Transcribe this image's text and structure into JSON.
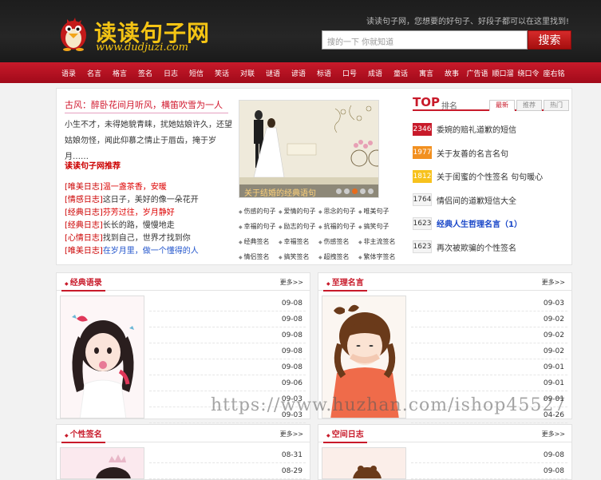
{
  "header": {
    "logo_text": "读读句子网",
    "logo_domain": "www.dudjuzi.com",
    "slogan": "读读句子网，您想要的好句子、好段子都可以在这里找到!",
    "search_placeholder": "搜的一下 你就知道",
    "search_button": "搜索"
  },
  "nav": [
    "语录",
    "名言",
    "格言",
    "签名",
    "日志",
    "短信",
    "笑话",
    "对联",
    "谜语",
    "谚语",
    "标语",
    "口号",
    "成语",
    "童话",
    "寓言",
    "故事",
    "广告语",
    "顺口溜",
    "绕口令",
    "座右铭"
  ],
  "featured": {
    "title": "古风：醉卧花间月听风，横笛吹雪为一人",
    "body": "小生不才，未得她貌青睐，扰她姑娘许久，还望姑娘勿怪，闻此仰慕之情止于唇齿，掩于岁月……"
  },
  "recommend": {
    "title": "读读句子网推荐",
    "items": [
      {
        "cat": "[唯美日志]",
        "text": "温一盏茶香，安暖",
        "style": "red"
      },
      {
        "cat": "[情感日志]",
        "text": "这日子，美好的像一朵花开",
        "style": ""
      },
      {
        "cat": "[经典日志]",
        "text": "芬芳过往，岁月静好",
        "style": "red"
      },
      {
        "cat": "[经典日志]",
        "text": "长长的路，慢慢地走",
        "style": ""
      },
      {
        "cat": "[心情日志]",
        "text": "找到自己，世界才找到你",
        "style": ""
      },
      {
        "cat": "[唯美日志]",
        "text": "在岁月里，做一个懂得的人",
        "style": "blue"
      }
    ]
  },
  "slider": {
    "caption": "关于结婚的经典语句",
    "dots": 5,
    "active_dot": 2
  },
  "tags": [
    "伤感的句子",
    "爱情的句子",
    "思念的句子",
    "唯美句子",
    "幸福的句子",
    "励志的句子",
    "抗福的句子",
    "搞笑句子",
    "经典签名",
    "幸福签名",
    "伤感签名",
    "非主流签名",
    "情侣签名",
    "搞笑签名",
    "超拽签名",
    "繁体字签名"
  ],
  "top": {
    "title": "TOP",
    "subtitle": "排名",
    "tabs": [
      "最新",
      "推荐",
      "热门"
    ],
    "active_tab": 0,
    "items": [
      {
        "num": "2346",
        "text": "委婉的赔礼道歉的短信",
        "rank_class": "r1",
        "hl": false
      },
      {
        "num": "1977",
        "text": "关于友善的名言名句",
        "rank_class": "r2",
        "hl": false
      },
      {
        "num": "1812",
        "text": "关于闺蜜的个性签名 句句暖心",
        "rank_class": "r3",
        "hl": false
      },
      {
        "num": "1764",
        "text": "情侣间的道歉短信大全",
        "rank_class": "",
        "hl": false
      },
      {
        "num": "1623",
        "text": "经典人生哲理名言（1）",
        "rank_class": "",
        "hl": true
      },
      {
        "num": "1623",
        "text": "再次被欺骗的个性签名",
        "rank_class": "",
        "hl": false
      }
    ]
  },
  "sections": [
    {
      "title": "经典语录",
      "more": "更多>>",
      "dates": [
        "09-08",
        "09-08",
        "09-08",
        "09-08",
        "09-08",
        "09-06",
        "09-03",
        "09-03"
      ]
    },
    {
      "title": "至理名言",
      "more": "更多>>",
      "dates": [
        "09-03",
        "09-02",
        "09-02",
        "09-02",
        "09-01",
        "09-01",
        "09-01",
        "04-26"
      ]
    },
    {
      "title": "个性签名",
      "more": "更多>>",
      "dates": [
        "08-31",
        "08-29"
      ]
    },
    {
      "title": "空间日志",
      "more": "更多>>",
      "dates": [
        "09-08",
        "09-08"
      ]
    }
  ],
  "watermark": "https://www.huzhan.com/ishop45527"
}
